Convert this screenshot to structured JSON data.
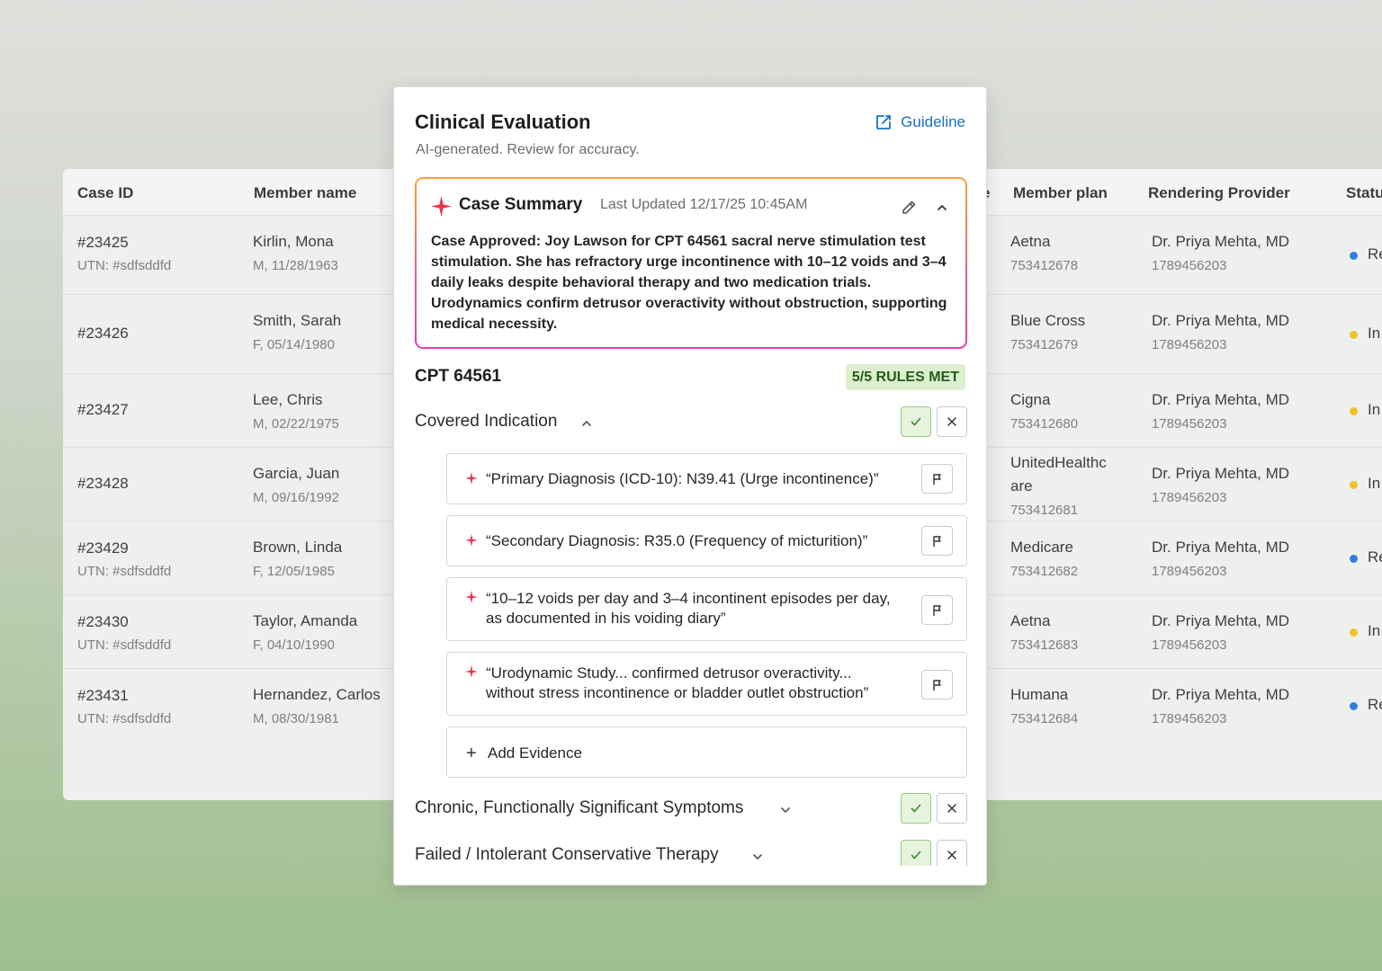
{
  "table": {
    "headers": {
      "case_id": "Case ID",
      "member_name": "Member name",
      "partial_header": "e",
      "member_plan": "Member plan",
      "rendering_provider": "Rendering Provider",
      "status": "Statu"
    },
    "rows": [
      {
        "case_id": "#23425",
        "utn": "UTN: #sdfsddfd",
        "name": "Kirlin, Mona",
        "demo": "M, 11/28/1963",
        "plan": "Aetna",
        "plan_id": "753412678",
        "provider": "Dr. Priya Mehta, MD",
        "npi": "1789456203",
        "status": "Re",
        "status_color": "#2f7fe0"
      },
      {
        "case_id": "#23426",
        "utn": "",
        "name": "Smith, Sarah",
        "demo": "F, 05/14/1980",
        "plan": "Blue Cross",
        "plan_id": "753412679",
        "provider": "Dr. Priya Mehta, MD",
        "npi": "1789456203",
        "status": "In",
        "status_color": "#f0c22a"
      },
      {
        "case_id": "#23427",
        "utn": "",
        "name": "Lee, Chris",
        "demo": "M, 02/22/1975",
        "plan": "Cigna",
        "plan_id": "753412680",
        "provider": "Dr. Priya Mehta, MD",
        "npi": "1789456203",
        "status": "In",
        "status_color": "#f0c22a"
      },
      {
        "case_id": "#23428",
        "utn": "",
        "name": "Garcia, Juan",
        "demo": "M, 09/16/1992",
        "plan": "UnitedHealthc are",
        "plan_line1": "UnitedHealthc",
        "plan_line2": "are",
        "plan_id": "753412681",
        "provider": "Dr. Priya Mehta, MD",
        "npi": "1789456203",
        "status": "In",
        "status_color": "#f0c22a"
      },
      {
        "case_id": "#23429",
        "utn": "UTN: #sdfsddfd",
        "name": "Brown, Linda",
        "demo": "F, 12/05/1985",
        "plan": "Medicare",
        "plan_id": "753412682",
        "provider": "Dr. Priya Mehta, MD",
        "npi": "1789456203",
        "status": "Re",
        "status_color": "#2f7fe0"
      },
      {
        "case_id": "#23430",
        "utn": "UTN: #sdfsddfd",
        "name": "Taylor, Amanda",
        "demo": "F, 04/10/1990",
        "plan": "Aetna",
        "plan_id": "753412683",
        "provider": "Dr. Priya Mehta, MD",
        "npi": "1789456203",
        "status": "In",
        "status_color": "#f0c22a"
      },
      {
        "case_id": "#23431",
        "utn": "UTN: #sdfsddfd",
        "name": "Hernandez, Carlos",
        "demo": "M, 08/30/1981",
        "plan": "Humana",
        "plan_id": "753412684",
        "provider": "Dr. Priya Mehta, MD",
        "npi": "1789456203",
        "status": "Re",
        "status_color": "#2f7fe0"
      }
    ]
  },
  "modal": {
    "title": "Clinical Evaluation",
    "subtitle": "AI-generated. Review for accuracy.",
    "guideline_label": "Guideline",
    "guideline_icon": "external-link-icon",
    "summary": {
      "title": "Case Summary",
      "updated": "Last Updated 12/17/25 10:45AM",
      "body": "Case Approved: Joy Lawson for CPT 64561 sacral nerve stimulation test stimulation. She has refractory urge incontinence with 10–12 voids and 3–4 daily leaks despite behavioral therapy and two medication trials. Urodynamics confirm detrusor overactivity without obstruction, supporting medical necessity."
    },
    "cpt": "CPT 64561",
    "rules_badge": "5/5 RULES MET",
    "sections": [
      {
        "label": "Covered Indication",
        "expanded": true
      },
      {
        "label": "Chronic, Functionally Significant Symptoms",
        "expanded": false
      },
      {
        "label": "Failed / Intolerant Conservative Therapy",
        "expanded": false
      }
    ],
    "evidence": [
      "“Primary Diagnosis (ICD-10): N39.41 (Urge incontinence)”",
      "“Secondary Diagnosis: R35.0 (Frequency of micturition)”",
      "“10–12 voids per day and 3–4 incontinent episodes per day, as documented in his voiding diary”",
      "“Urodynamic Study... confirmed detrusor overactivity... without stress incontinence or bladder outlet obstruction”"
    ],
    "add_evidence_label": "Add Evidence",
    "colors": {
      "accent": "#1b6fc4",
      "spark": "#e8374f",
      "approve_bg": "#e6f4de",
      "approve_border": "#98c98a"
    }
  }
}
